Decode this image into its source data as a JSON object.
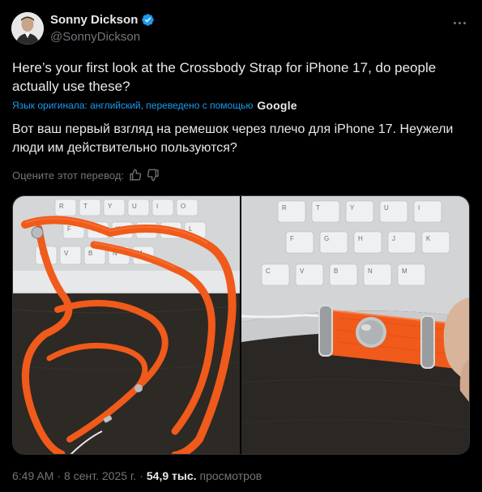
{
  "author": {
    "name": "Sonny Dickson",
    "handle": "@SonnyDickson"
  },
  "tweet": {
    "text_original": "Here’s your first look at the Crossbody Strap for iPhone 17, do people actually use these?",
    "translation_note": "Язык оригинала: английский, переведено с помощью",
    "translation_provider": "Google",
    "text_translated": "Вот ваш первый взгляд на ремешок через плечо для iPhone 17. Неужели люди им действительно пользуются?",
    "rate_prompt": "Оцените этот перевод:"
  },
  "meta": {
    "time": "6:49 AM",
    "separator": "·",
    "date": "8 сент. 2025 г.",
    "views_count": "54,9 тыс.",
    "views_label": "просмотров"
  },
  "media": {
    "keyboard_keys_left": [
      "R",
      "T",
      "Y",
      "U",
      "I",
      "O",
      "F",
      "G",
      "H",
      "J",
      "K",
      "L",
      "C",
      "V",
      "B",
      "N",
      "M"
    ],
    "keyboard_keys_right": [
      "R",
      "T",
      "Y",
      "U",
      "I",
      "F",
      "G",
      "H",
      "J",
      "K",
      "C",
      "V",
      "B",
      "N",
      "M"
    ]
  },
  "colors": {
    "accent": "#1d9bf0",
    "muted": "#71767b",
    "text": "#e7e9ea",
    "strap_orange": "#f05a1a"
  }
}
